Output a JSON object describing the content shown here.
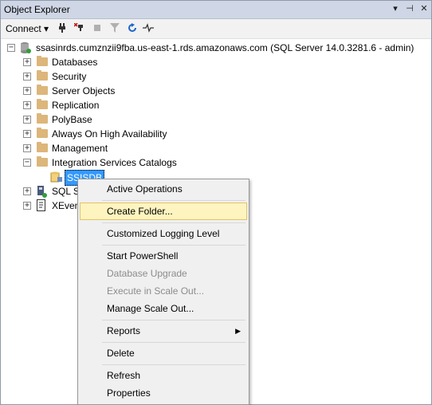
{
  "window": {
    "title": "Object Explorer",
    "controls": {
      "pin": "▾",
      "autohide": "⊣",
      "close": "✕"
    }
  },
  "toolbar": {
    "connect_label": "Connect ▾",
    "icons": [
      "connect-icon",
      "disconnect-icon",
      "stop-icon",
      "filter-icon",
      "refresh-icon",
      "activity-monitor-icon"
    ]
  },
  "tree": {
    "server": "ssasinrds.cumznzii9fba.us-east-1.rds.amazonaws.com (SQL Server 14.0.3281.6 - admin)",
    "nodes": [
      {
        "label": "Databases"
      },
      {
        "label": "Security"
      },
      {
        "label": "Server Objects"
      },
      {
        "label": "Replication"
      },
      {
        "label": "PolyBase"
      },
      {
        "label": "Always On High Availability"
      },
      {
        "label": "Management"
      },
      {
        "label": "Integration Services Catalogs"
      }
    ],
    "ssisdb": "SSISDB",
    "sql_agent": "SQL Se",
    "xevent": "XEven"
  },
  "context_menu": {
    "items": [
      {
        "label": "Active Operations",
        "enabled": true
      },
      {
        "label": "Create Folder...",
        "enabled": true,
        "highlighted": true
      },
      {
        "label": "Customized Logging Level",
        "enabled": true
      },
      {
        "label": "Start PowerShell",
        "enabled": true
      },
      {
        "label": "Database Upgrade",
        "enabled": false
      },
      {
        "label": "Execute in Scale Out...",
        "enabled": false
      },
      {
        "label": "Manage Scale Out...",
        "enabled": true
      },
      {
        "label": "Reports",
        "enabled": true,
        "submenu": true
      },
      {
        "label": "Delete",
        "enabled": true
      },
      {
        "label": "Refresh",
        "enabled": true
      },
      {
        "label": "Properties",
        "enabled": true
      }
    ]
  },
  "colors": {
    "titlebar": "#cfd6e5",
    "selection": "#3399ff",
    "menu_highlight": "#fdf4bf",
    "folder": "#dcb67a"
  }
}
